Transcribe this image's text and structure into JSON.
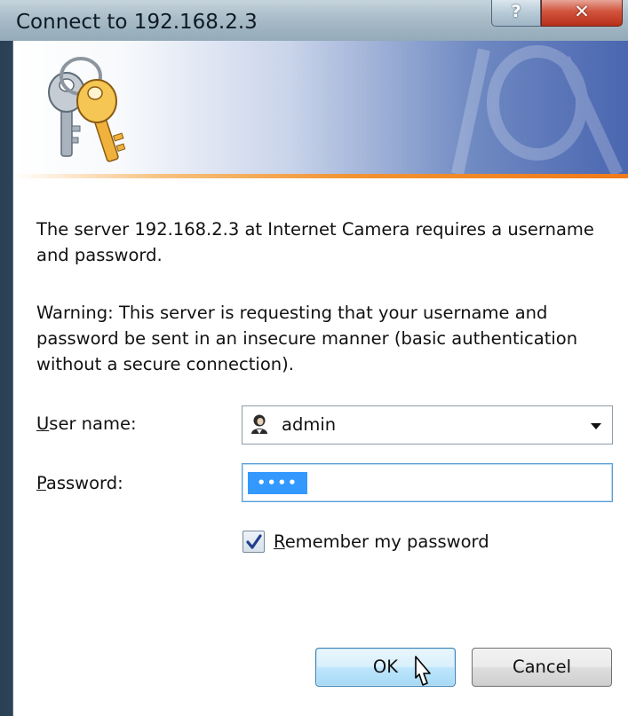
{
  "window": {
    "title": "Connect to 192.168.2.3",
    "help_button": "?",
    "close_button": "✕"
  },
  "banner": {
    "icon": "keys-icon",
    "watermark": "keys-watermark-icon",
    "accent_line_color": "#f07a1a"
  },
  "message": {
    "text": "The server 192.168.2.3 at Internet Camera requires a username and password.",
    "warning": "Warning: This server is requesting that your username and password be sent in an insecure manner (basic authentication without a secure connection)."
  },
  "form": {
    "username": {
      "label_accel": "U",
      "label_rest": "ser name:",
      "value": "admin",
      "icon": "user-icon",
      "dropdown_icon": "chevron-down-icon"
    },
    "password": {
      "label_accel": "P",
      "label_rest": "assword:",
      "masked_value": "••••"
    },
    "remember": {
      "checked": true,
      "label_accel": "R",
      "label_rest": "emember my password"
    }
  },
  "buttons": {
    "ok_label": "OK",
    "cancel_label": "Cancel"
  },
  "colors": {
    "selection": "#3399ff",
    "close_button": "#c7432b",
    "ok_button_focus": "#3c7fb1"
  }
}
